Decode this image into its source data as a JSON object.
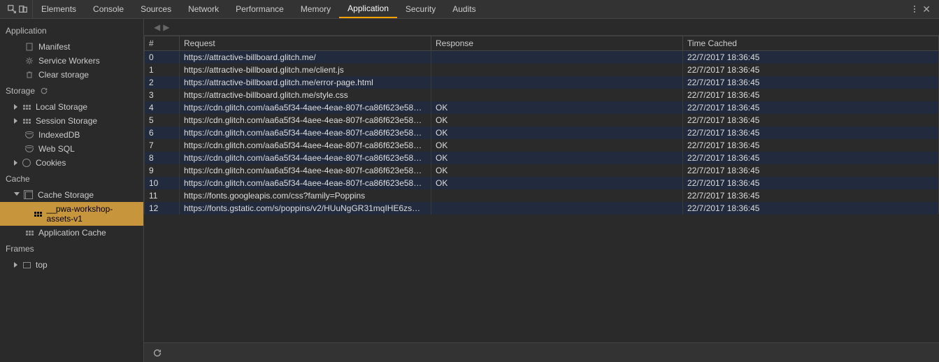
{
  "tabs": [
    "Elements",
    "Console",
    "Sources",
    "Network",
    "Performance",
    "Memory",
    "Application",
    "Security",
    "Audits"
  ],
  "active_tab_index": 6,
  "sidebar": {
    "groups": [
      {
        "title": "Application",
        "items": [
          {
            "label": "Manifest",
            "icon": "doc"
          },
          {
            "label": "Service Workers",
            "icon": "gear"
          },
          {
            "label": "Clear storage",
            "icon": "trash"
          }
        ]
      },
      {
        "title": "Storage",
        "refresh": true,
        "items": [
          {
            "label": "Local Storage",
            "icon": "grid",
            "tri": "closed"
          },
          {
            "label": "Session Storage",
            "icon": "grid",
            "tri": "closed"
          },
          {
            "label": "IndexedDB",
            "icon": "db"
          },
          {
            "label": "Web SQL",
            "icon": "db"
          },
          {
            "label": "Cookies",
            "icon": "cookie",
            "tri": "closed"
          }
        ]
      },
      {
        "title": "Cache",
        "items": [
          {
            "label": "Cache Storage",
            "icon": "folder",
            "tri": "open",
            "children": [
              {
                "label": "__pwa-workshop-assets-v1",
                "icon": "grid",
                "selected": true
              }
            ]
          },
          {
            "label": "Application Cache",
            "icon": "grid"
          }
        ]
      },
      {
        "title": "Frames",
        "items": [
          {
            "label": "top",
            "icon": "frame",
            "tri": "closed"
          }
        ]
      }
    ]
  },
  "table": {
    "headers": [
      "#",
      "Request",
      "Response",
      "Time Cached"
    ],
    "rows": [
      {
        "idx": "0",
        "req": "https://attractive-billboard.glitch.me/",
        "resp": "",
        "time": "22/7/2017 18:36:45"
      },
      {
        "idx": "1",
        "req": "https://attractive-billboard.glitch.me/client.js",
        "resp": "",
        "time": "22/7/2017 18:36:45"
      },
      {
        "idx": "2",
        "req": "https://attractive-billboard.glitch.me/error-page.html",
        "resp": "",
        "time": "22/7/2017 18:36:45"
      },
      {
        "idx": "3",
        "req": "https://attractive-billboard.glitch.me/style.css",
        "resp": "",
        "time": "22/7/2017 18:36:45"
      },
      {
        "idx": "4",
        "req": "https://cdn.glitch.com/aa6a5f34-4aee-4eae-807f-ca86f623e58…",
        "resp": "OK",
        "time": "22/7/2017 18:36:45"
      },
      {
        "idx": "5",
        "req": "https://cdn.glitch.com/aa6a5f34-4aee-4eae-807f-ca86f623e58…",
        "resp": "OK",
        "time": "22/7/2017 18:36:45"
      },
      {
        "idx": "6",
        "req": "https://cdn.glitch.com/aa6a5f34-4aee-4eae-807f-ca86f623e58…",
        "resp": "OK",
        "time": "22/7/2017 18:36:45"
      },
      {
        "idx": "7",
        "req": "https://cdn.glitch.com/aa6a5f34-4aee-4eae-807f-ca86f623e58…",
        "resp": "OK",
        "time": "22/7/2017 18:36:45"
      },
      {
        "idx": "8",
        "req": "https://cdn.glitch.com/aa6a5f34-4aee-4eae-807f-ca86f623e58…",
        "resp": "OK",
        "time": "22/7/2017 18:36:45"
      },
      {
        "idx": "9",
        "req": "https://cdn.glitch.com/aa6a5f34-4aee-4eae-807f-ca86f623e58…",
        "resp": "OK",
        "time": "22/7/2017 18:36:45"
      },
      {
        "idx": "10",
        "req": "https://cdn.glitch.com/aa6a5f34-4aee-4eae-807f-ca86f623e58…",
        "resp": "OK",
        "time": "22/7/2017 18:36:45"
      },
      {
        "idx": "11",
        "req": "https://fonts.googleapis.com/css?family=Poppins",
        "resp": "",
        "time": "22/7/2017 18:36:45"
      },
      {
        "idx": "12",
        "req": "https://fonts.gstatic.com/s/poppins/v2/HUuNgGR31mqIHE6zs…",
        "resp": "",
        "time": "22/7/2017 18:36:45"
      }
    ]
  }
}
